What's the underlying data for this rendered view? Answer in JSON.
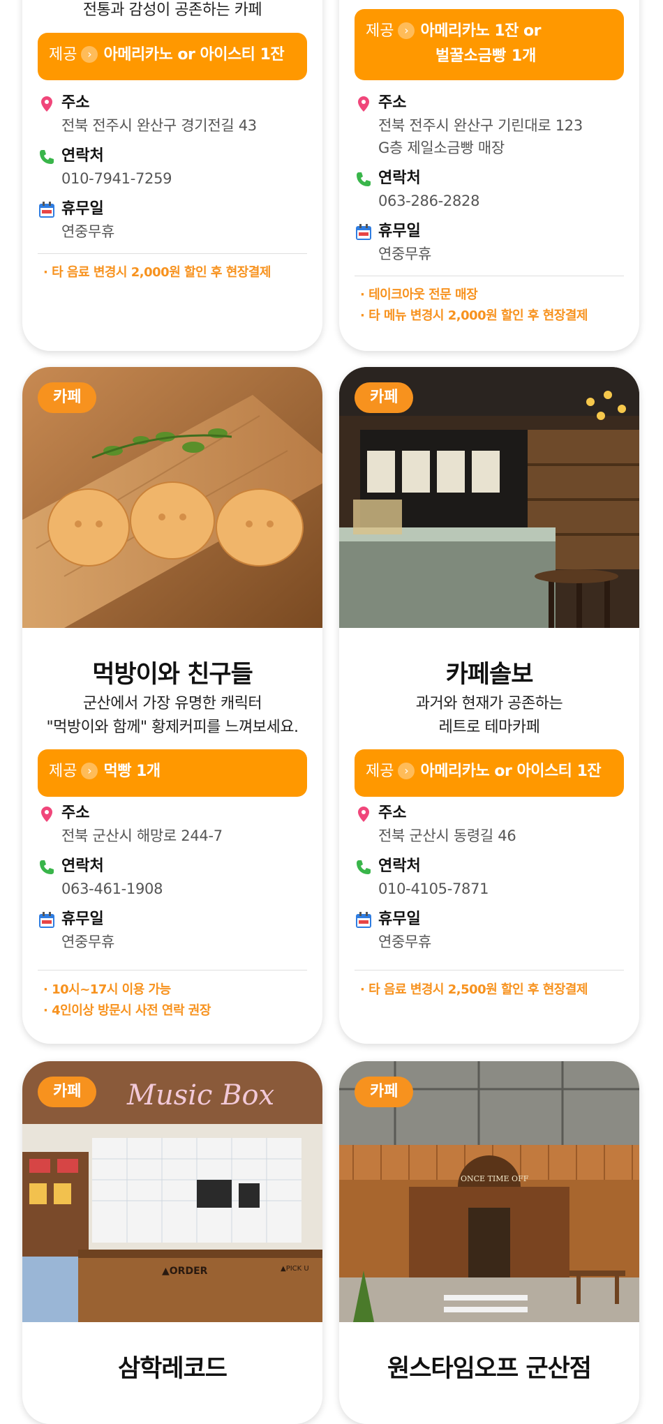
{
  "colors": {
    "accent": "#ff9800",
    "badge": "#f7921e",
    "note": "#f7921e"
  },
  "labels": {
    "offer": "제공",
    "address": "주소",
    "contact": "연락처",
    "holiday": "휴무일"
  },
  "cards": [
    {
      "desc": "전통과 감성이 공존하는 카페",
      "offer": "아메리카노 or 아이스티 1잔",
      "address": "전북 전주시 완산구 경기전길 43",
      "phone": "010-7941-7259",
      "holiday": "연중무휴",
      "notes": [
        "· 타 음료 변경시 2,000원 할인 후 현장결제"
      ]
    },
    {
      "offer_line1": "아메리카노 1잔 or",
      "offer_line2": "벌꿀소금빵 1개",
      "address_line1": "전북 전주시 완산구 기린대로 123",
      "address_line2": "G층 제일소금빵 매장",
      "phone": "063-286-2828",
      "holiday": "연중무휴",
      "notes": [
        "· 테이크아웃 전문 매장",
        "· 타 메뉴 변경시 2,000원 할인 후 현장결제"
      ]
    },
    {
      "badge": "카페",
      "photo_icon": "photo-cookies-icon",
      "name": "먹방이와 친구들",
      "desc_line1": "군산에서 가장 유명한 캐릭터",
      "desc_line2": "\"먹방이와 함께\" 황제커피를 느껴보세요.",
      "offer": "먹빵 1개",
      "address": "전북 군산시 해망로 244-7",
      "phone": "063-461-1908",
      "holiday": "연중무휴",
      "notes": [
        "· 10시~17시 이용 가능",
        "· 4인이상 방문시 사전 연락 권장"
      ]
    },
    {
      "badge": "카페",
      "photo_icon": "photo-cafe-interior-icon",
      "name": "카페솔보",
      "desc_line1": "과거와 현재가 공존하는",
      "desc_line2": "레트로 테마카페",
      "offer": "아메리카노 or 아이스티 1잔",
      "address": "전북 군산시 동령길 46",
      "phone": "010-4105-7871",
      "holiday": "연중무휴",
      "notes": [
        "· 타 음료 변경시 2,500원 할인 후 현장결제"
      ]
    },
    {
      "badge": "카페",
      "photo_icon": "photo-record-shop-icon",
      "photo_sign": "Music Box",
      "photo_order": "▲ORDER",
      "photo_pickup": "▲PICK U",
      "name": "삼학레코드"
    },
    {
      "badge": "카페",
      "photo_icon": "photo-storefront-icon",
      "photo_sign": "ONCE TIME OFF",
      "name": "원스타임오프 군산점"
    }
  ]
}
